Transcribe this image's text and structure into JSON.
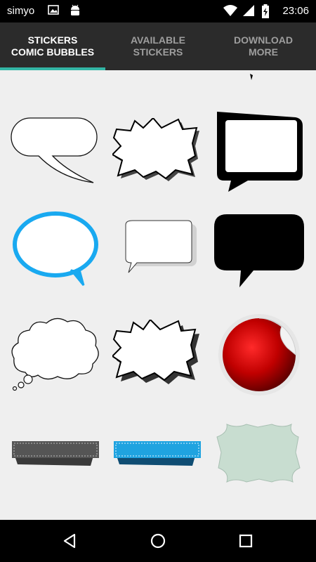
{
  "status_bar": {
    "carrier": "simyo",
    "time": "23:06",
    "icons": [
      "image-icon",
      "android-icon",
      "wifi-icon",
      "signal-icon",
      "battery-charging-icon"
    ]
  },
  "tabs": [
    {
      "label": "STICKERS\nCOMIC BUBBLES",
      "active": true
    },
    {
      "label": "AVAILABLE\nSTICKERS",
      "active": false
    },
    {
      "label": "DOWNLOAD\nMORE",
      "active": false
    }
  ],
  "stickers": [
    "rounded-speech-bubble-outline",
    "jagged-burst-bubble",
    "thick-black-frame-bubble",
    "blue-oval-speech-bubble",
    "small-square-speech-bubble",
    "black-speech-bubble",
    "thought-cloud-bubble",
    "jagged-burst-bubble-shadow",
    "red-peeling-sticker",
    "gray-ribbon-banner",
    "blue-ribbon-banner",
    "green-paper-frame"
  ],
  "navigation": [
    "back-icon",
    "home-icon",
    "recents-icon"
  ],
  "colors": {
    "tab_indicator": "#33b5a5",
    "tab_background": "#2b2b2b",
    "content_background": "#efefef",
    "blue_bubble": "#19a9f0",
    "red_sticker": "#c00000",
    "blue_ribbon": "#1fa3e0"
  }
}
